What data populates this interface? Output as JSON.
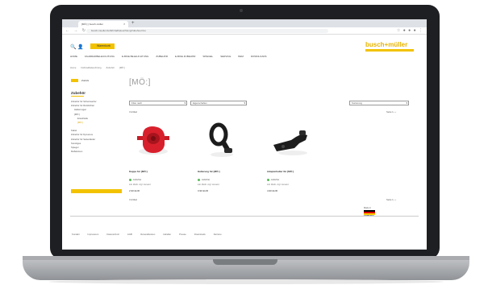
{
  "browser": {
    "tab_title": "[MÖ:] | busch-müller",
    "tab_close": "×",
    "new_tab": "+",
    "nav_icons": "← → ↻",
    "url": "busch-mueller.de/fahrradbeleuchtung/zubehoer/mo",
    "extension_icons": "☆ ● ● ● ⋮"
  },
  "header": {
    "logo": "busch+müller",
    "icons": "🔍 👤",
    "cart_label": "Warenkorb"
  },
  "nav": {
    "items": [
      "HOME",
      "FAHRRADBELEUCHTUNG",
      "E-BIKE BELEUCHTUNG",
      "ZUBEHÖR",
      "E-BIKE ZUBEHÖR",
      "SPIEGEL",
      "SERVICE",
      "B&M",
      "DOWNLOADS"
    ]
  },
  "breadcrumb": [
    "Home",
    "Fahrradbeleuchtung",
    "Zubehör",
    "[MÖ:]"
  ],
  "sidebar": {
    "back_label": "Zurück",
    "heading": "Zubehör",
    "items": [
      {
        "label": "Zubehör für Scheinwerfer",
        "level": 1,
        "highlight": false
      },
      {
        "label": "Zubehör für Rücklichter",
        "level": 1,
        "highlight": false
      },
      {
        "label": "Halterungen",
        "level": 2,
        "highlight": false
      },
      {
        "label": "[MÖ:]",
        "level": 2,
        "highlight": false
      },
      {
        "label": "Ersatzteile",
        "level": 3,
        "highlight": false
      },
      {
        "label": "[MÖ:]",
        "level": 3,
        "highlight": true
      },
      {
        "label": "Kabel",
        "level": 1,
        "highlight": false,
        "gap": true
      },
      {
        "label": "Zubehör für Dynamos",
        "level": 1,
        "highlight": false
      },
      {
        "label": "Zubehör für Seitenläufer",
        "level": 1,
        "highlight": false
      },
      {
        "label": "Sonstiges",
        "level": 1,
        "highlight": false
      },
      {
        "label": "Spiegel",
        "level": 1,
        "highlight": false
      },
      {
        "label": "Reflektoren",
        "level": 1,
        "highlight": false
      }
    ]
  },
  "main": {
    "title": "[MÖ:]",
    "filter1": "Filter nach",
    "filter2": "Eigenschaften",
    "sort": "Sortierung",
    "results_top": "3 Artikel",
    "pager_top": "Seite 1 ‹ ›",
    "results_bottom": "3 Artikel",
    "pager_bottom": "Seite 1 ‹ ›",
    "stock_text": "Lieferbar",
    "note_text": "inkl. MwSt. zzgl. Versand",
    "products": [
      {
        "name": "Kappe für [MÖ:]",
        "price": "2,90 EUR"
      },
      {
        "name": "Halterung für [MÖ:]",
        "price": "3,90 EUR"
      },
      {
        "name": "Adapterhalter für [MÖ:]",
        "price": "4,90 EUR"
      }
    ]
  },
  "badge": {
    "label": "Made in",
    "country": "GERMANY"
  },
  "footer": {
    "links": [
      "Kontakt",
      "Impressum",
      "Datenschutz",
      "AGB",
      "Versandkosten",
      "Händler",
      "Presse",
      "Downloads",
      "Karriere"
    ]
  },
  "colors": {
    "accent": "#f2c200",
    "laptop_frame": "#1e1f22",
    "stock_green": "#5bb85b",
    "product_red": "#d8202c"
  }
}
